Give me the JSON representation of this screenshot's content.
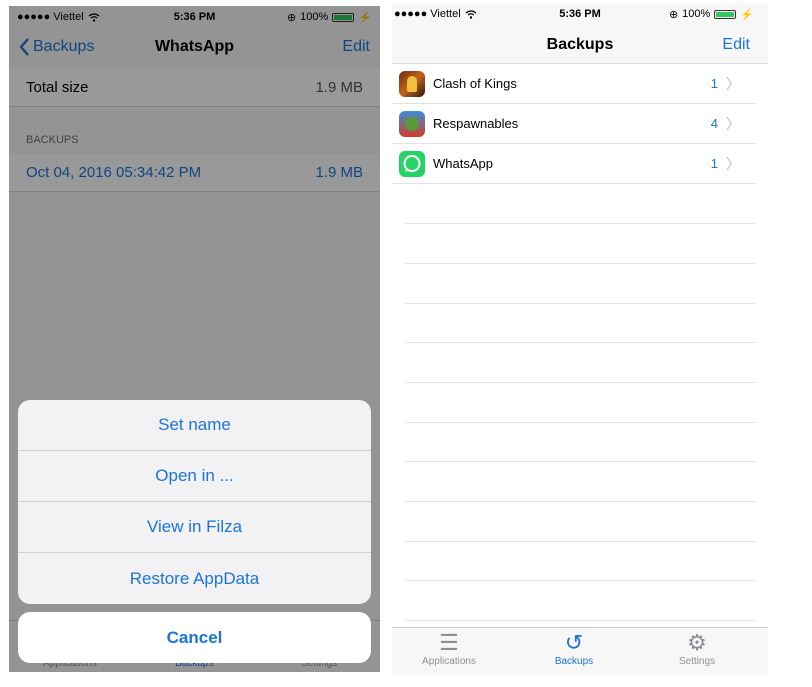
{
  "left": {
    "status": {
      "carrier": "●●●●● Viettel",
      "time": "5:36 PM",
      "battery": "100%"
    },
    "nav": {
      "back": "Backups",
      "title": "WhatsApp",
      "edit": "Edit"
    },
    "total": {
      "label": "Total size",
      "value": "1.9 MB"
    },
    "section": "BACKUPS",
    "backup": {
      "date": "Oct 04, 2016 05:34:42 PM",
      "size": "1.9 MB"
    },
    "tabs": [
      "Applications",
      "Backups",
      "Settings"
    ],
    "sheet": [
      "Set name",
      "Open in ...",
      "View in Filza",
      "Restore AppData"
    ],
    "cancel": "Cancel"
  },
  "right": {
    "status": {
      "carrier": "●●●●● Viettel",
      "time": "5:36 PM",
      "battery": "100%"
    },
    "nav": {
      "title": "Backups",
      "edit": "Edit"
    },
    "apps": [
      {
        "name": "Clash of Kings",
        "count": "1"
      },
      {
        "name": "Respawnables",
        "count": "4"
      },
      {
        "name": "WhatsApp",
        "count": "1"
      }
    ],
    "tabs": [
      "Applications",
      "Backups",
      "Settings"
    ]
  },
  "colors": {
    "accent": "#1c74d9",
    "whatsapp": "#25d366"
  }
}
